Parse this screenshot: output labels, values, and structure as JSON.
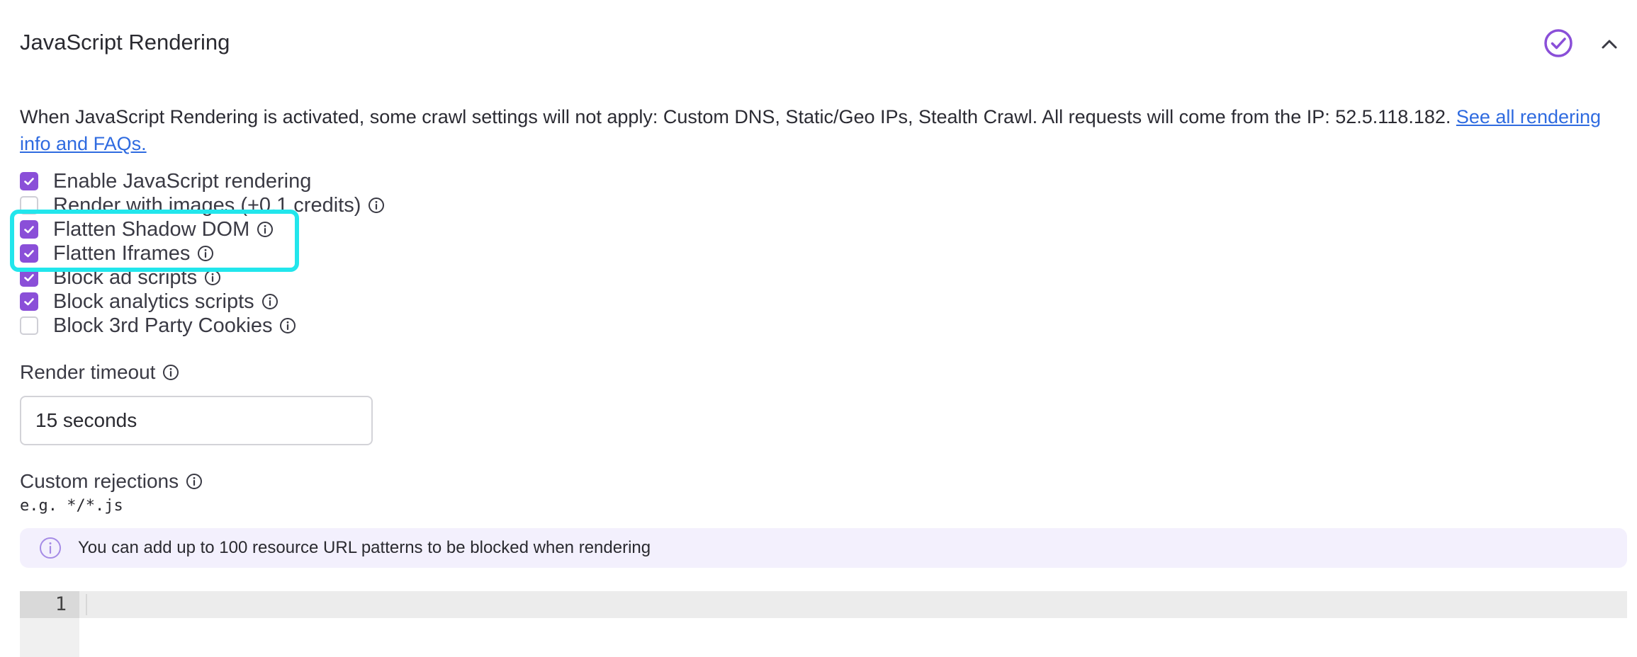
{
  "section": {
    "title": "JavaScript Rendering",
    "status_icon": "check-circle-icon",
    "toggle_icon": "chevron-up-icon"
  },
  "notice": {
    "text": "When JavaScript Rendering is activated, some crawl settings will not apply: Custom DNS, Static/Geo IPs, Stealth Crawl. All requests will come from the IP: 52.5.118.182. ",
    "link_text": "See all rendering info and FAQs."
  },
  "options": [
    {
      "label": "Enable JavaScript rendering",
      "checked": true,
      "has_info": false
    },
    {
      "label": "Render with images (+0.1 credits)",
      "checked": false,
      "has_info": true
    },
    {
      "label": "Flatten Shadow DOM",
      "checked": true,
      "has_info": true
    },
    {
      "label": "Flatten Iframes",
      "checked": true,
      "has_info": true
    },
    {
      "label": "Block ad scripts",
      "checked": true,
      "has_info": true
    },
    {
      "label": "Block analytics scripts",
      "checked": true,
      "has_info": true
    },
    {
      "label": "Block 3rd Party Cookies",
      "checked": false,
      "has_info": true
    }
  ],
  "render_timeout": {
    "label": "Render timeout",
    "value": "15 seconds"
  },
  "custom_rejections": {
    "label": "Custom rejections",
    "example": "e.g. */*.js",
    "banner_text": "You can add up to 100 resource URL patterns to be blocked when rendering",
    "editor_line_number": "1"
  },
  "colors": {
    "accent": "#8a4fd8",
    "highlight": "#22e6ec",
    "link": "#2f6be0",
    "banner_bg": "#f3f0fd"
  }
}
